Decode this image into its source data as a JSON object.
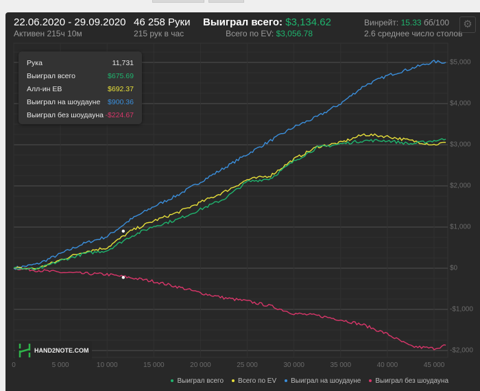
{
  "header": {
    "date_range": "22.06.2020 - 29.09.2020",
    "active": "Активен 215ч 10м",
    "hands": "46 258 Руки",
    "hands_per_hour": "215 рук в час",
    "won_label": "Выиграл всего:",
    "won_value": "$3,134.62",
    "ev_label": "Всего по EV:",
    "ev_value": "$3,056.78",
    "winrate_label": "Винрейт:",
    "winrate_value": "15.33",
    "winrate_unit": "бб/100",
    "tables": "2.6 среднее число столов"
  },
  "tooltip": [
    {
      "label": "Рука",
      "value": "11,731",
      "color": "#e6e6e6"
    },
    {
      "label": "Выиграл всего",
      "value": "$675.69",
      "color": "#1fb46e"
    },
    {
      "label": "Алл-ин EB",
      "value": "$692.37",
      "color": "#e8e03a"
    },
    {
      "label": "Выиграл на шоудауне",
      "value": "$900.36",
      "color": "#3b8fdc"
    },
    {
      "label": "Выиграл без шоудауна",
      "value": "-$224.67",
      "color": "#d9366a"
    }
  ],
  "logo": "HAND2NOTE.COM",
  "chart_data": {
    "type": "line",
    "xlim": [
      0,
      46258
    ],
    "ylim": [
      -2200,
      5400
    ],
    "x_ticks": [
      "0",
      "5 000",
      "10 000",
      "15 000",
      "20 000",
      "25 000",
      "30 000",
      "35 000",
      "40 000",
      "45 000"
    ],
    "y_ticks": [
      "$5,000",
      "$4,000",
      "$3,000",
      "$2,000",
      "$1,000",
      "$0",
      "-$1,000",
      "-$2,000"
    ],
    "x": [
      0,
      2500,
      5000,
      7500,
      10000,
      12500,
      15000,
      17500,
      20000,
      22500,
      25000,
      27500,
      30000,
      32500,
      35000,
      37500,
      40000,
      42500,
      45000,
      46258
    ],
    "series": [
      {
        "name": "Выиграл на шоудауне",
        "color": "#3b8fdc",
        "values": [
          0,
          100,
          350,
          600,
          770,
          1180,
          1500,
          1770,
          2100,
          2430,
          2770,
          3100,
          3430,
          3680,
          4000,
          4430,
          4680,
          4850,
          5020,
          5000
        ]
      },
      {
        "name": "Выиграл без шоудауна",
        "color": "#d9366a",
        "values": [
          0,
          -50,
          -100,
          -130,
          -150,
          -230,
          -320,
          -450,
          -600,
          -720,
          -800,
          -920,
          -1100,
          -1150,
          -1250,
          -1380,
          -1600,
          -1900,
          -1950,
          -1870
        ]
      },
      {
        "name": "Всего по EV",
        "color": "#e8e03a",
        "values": [
          0,
          -10,
          200,
          400,
          500,
          900,
          1150,
          1350,
          1600,
          1850,
          2150,
          2250,
          2650,
          2950,
          3050,
          3250,
          3200,
          3100,
          3000,
          3057
        ]
      },
      {
        "name": "Выиграл всего",
        "color": "#1fb46e",
        "values": [
          0,
          -30,
          180,
          350,
          430,
          770,
          1020,
          1180,
          1430,
          1680,
          2100,
          2180,
          2600,
          2930,
          3020,
          3100,
          3100,
          3020,
          3100,
          3134
        ]
      }
    ],
    "legend": [
      "Выиграл всего",
      "Всего по EV",
      "Выиграл на шоудауне",
      "Выиграл без шоудауна"
    ],
    "legend_colors": [
      "#1fb46e",
      "#e8e03a",
      "#3b8fdc",
      "#d9366a"
    ],
    "hover_x": 11731,
    "hover_points": [
      900.36,
      -224.67
    ],
    "legend_position": "bottom-right"
  }
}
